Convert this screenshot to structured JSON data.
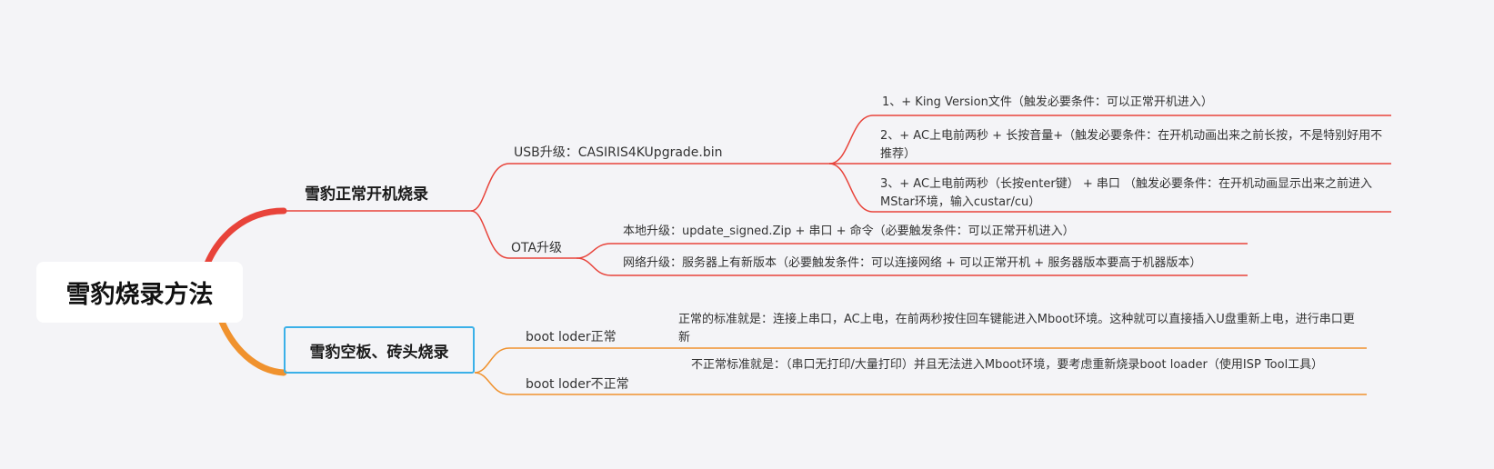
{
  "root": {
    "label": "雪豹烧录方法"
  },
  "branches": [
    {
      "label": "雪豹正常开机烧录",
      "color": "#e8433a",
      "children": [
        {
          "label": "USB升级：CASIRIS4KUpgrade.bin",
          "children": [
            "1、+ King Version文件（触发必要条件：可以正常开机进入）",
            "2、+ AC上电前两秒 + 长按音量+（触发必要条件：在开机动画出来之前长按，不是特别好用不推荐）",
            "3、+ AC上电前两秒（长按enter键） + 串口 （触发必要条件：在开机动画显示出来之前进入MStar环境，输入custar/cu）"
          ]
        },
        {
          "label": "OTA升级",
          "children": [
            "本地升级：update_signed.Zip + 串口 + 命令（必要触发条件：可以正常开机进入）",
            "网络升级：服务器上有新版本（必要触发条件：可以连接网络 + 可以正常开机 + 服务器版本要高于机器版本）"
          ]
        }
      ]
    },
    {
      "label": "雪豹空板、砖头烧录",
      "color": "#f0922e",
      "children": [
        {
          "label": "boot loder正常",
          "children": [
            "正常的标准就是：连接上串口，AC上电，在前两秒按住回车键能进入Mboot环境。这种就可以直接插入U盘重新上电，进行串口更新"
          ]
        },
        {
          "label": "boot loder不正常",
          "children": [
            "不正常标准就是：（串口无打印/大量打印）并且无法进入Mboot环境，要考虑重新烧录boot loader（使用ISP Tool工具）"
          ]
        }
      ]
    }
  ]
}
